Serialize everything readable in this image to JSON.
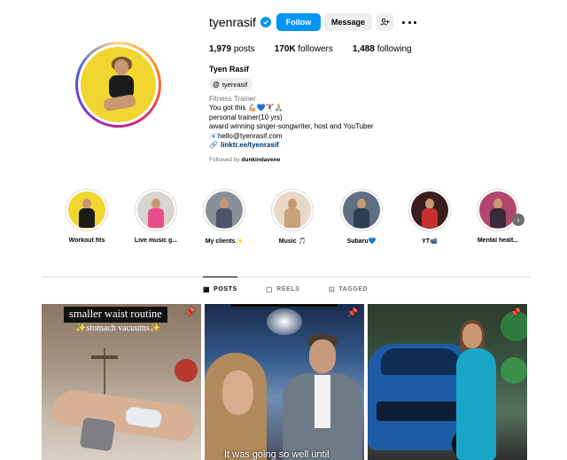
{
  "profile": {
    "username": "tyenrasif",
    "follow_label": "Follow",
    "message_label": "Message",
    "stats": {
      "posts_count": "1,979",
      "posts_label": "posts",
      "followers_count": "170K",
      "followers_label": "followers",
      "following_count": "1,488",
      "following_label": "following"
    },
    "full_name": "Tyen Rasif",
    "threads_handle": "tyenrasif",
    "category": "Fitness Trainer",
    "bio_lines": [
      "You got this 💪🏼💙🏋️‍♀️🙏🏼",
      "personal trainer(10 yrs)",
      "award winning singer-songwriter, host and YouTuber",
      "📧hello@tyenrasif.com"
    ],
    "link": "linktr.ee/tyenrasif",
    "followed_by_prefix": "Followed by",
    "followed_by_user": "dunkindavene"
  },
  "highlights": [
    {
      "label": "Workout fits",
      "bg": "#f0d62e",
      "body": "#1b1b1b"
    },
    {
      "label": "Live music g...",
      "bg": "#d9d4cf",
      "body": "#e84d8a"
    },
    {
      "label": "My clients✨",
      "bg": "#8a8f99",
      "body": "#4d5566"
    },
    {
      "label": "Music 🎵",
      "bg": "#e8d8c8",
      "body": "#c7a27a"
    },
    {
      "label": "Subaru💙",
      "bg": "#5d6f80",
      "body": "#2e3e52"
    },
    {
      "label": "YT📹",
      "bg": "#3a1e1e",
      "body": "#c43030"
    },
    {
      "label": "Mental healt...",
      "bg": "#b4456e",
      "body": "#3a2a3a"
    }
  ],
  "tabs": {
    "posts": "POSTS",
    "reels": "REELS",
    "tagged": "TAGGED"
  },
  "posts": {
    "post1_title": "smaller waist routine",
    "post1_subtitle": "✨stomach vacuums✨",
    "post2_caption": "It was going so well until"
  },
  "colors": {
    "accent": "#0095f6",
    "link": "#00376b",
    "muted": "#737373"
  }
}
